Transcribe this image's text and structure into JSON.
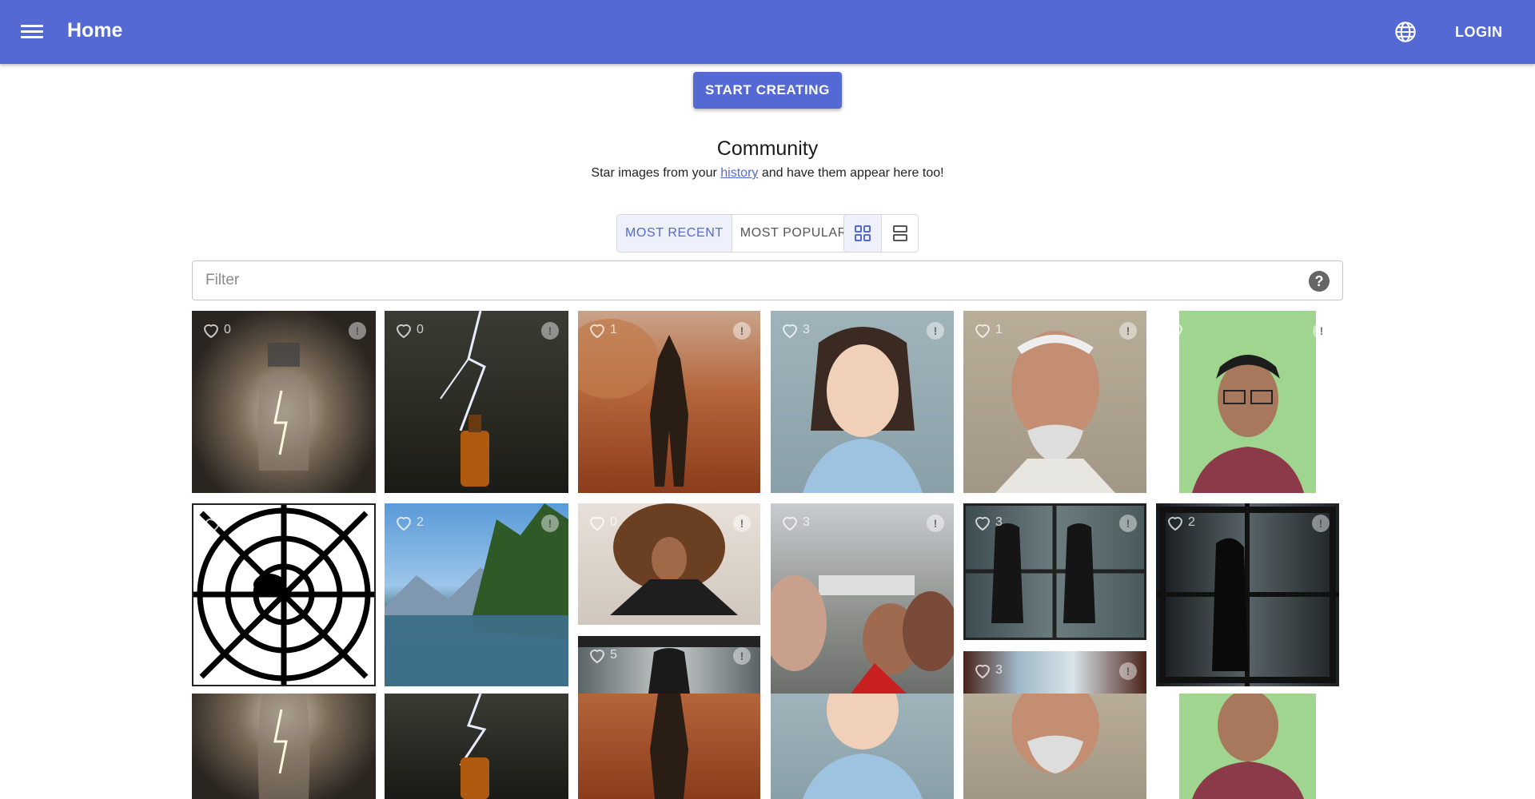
{
  "header": {
    "title": "Home",
    "login_label": "LOGIN"
  },
  "start_label": "START CREATING",
  "community": {
    "title": "Community",
    "subtitle_before": "Star images from your",
    "history_link": "history",
    "subtitle_after": "and have them appear here too!"
  },
  "sort": {
    "recent": "MOST RECENT",
    "popular": "MOST POPULAR"
  },
  "filter": {
    "placeholder": "Filter",
    "help": "?"
  },
  "colors": {
    "primary": "#5469d4"
  },
  "images": [
    {
      "subject": "glass bottle with lightning inside",
      "likes": "0"
    },
    {
      "subject": "lightning striking whiskey bottle",
      "likes": "0"
    },
    {
      "subject": "armored warrior in desert",
      "likes": "1"
    },
    {
      "subject": "smiling nurse portrait",
      "likes": "3"
    },
    {
      "subject": "old man with mustache",
      "likes": "1"
    },
    {
      "subject": "man with glasses green background",
      "likes": ""
    },
    {
      "subject": "spider web line art",
      "likes": ""
    },
    {
      "subject": "mountain river forest",
      "likes": "2"
    },
    {
      "subject": "woman with big curly hair",
      "likes": "0"
    },
    {
      "subject": "selfie family in parking lot",
      "likes": "3"
    },
    {
      "subject": "girls at misty window",
      "likes": "3"
    },
    {
      "subject": "girl silhouette at window",
      "likes": "2"
    },
    {
      "subject": "girl facing window",
      "likes": "5"
    },
    {
      "subject": "window with curtains",
      "likes": "3"
    }
  ]
}
